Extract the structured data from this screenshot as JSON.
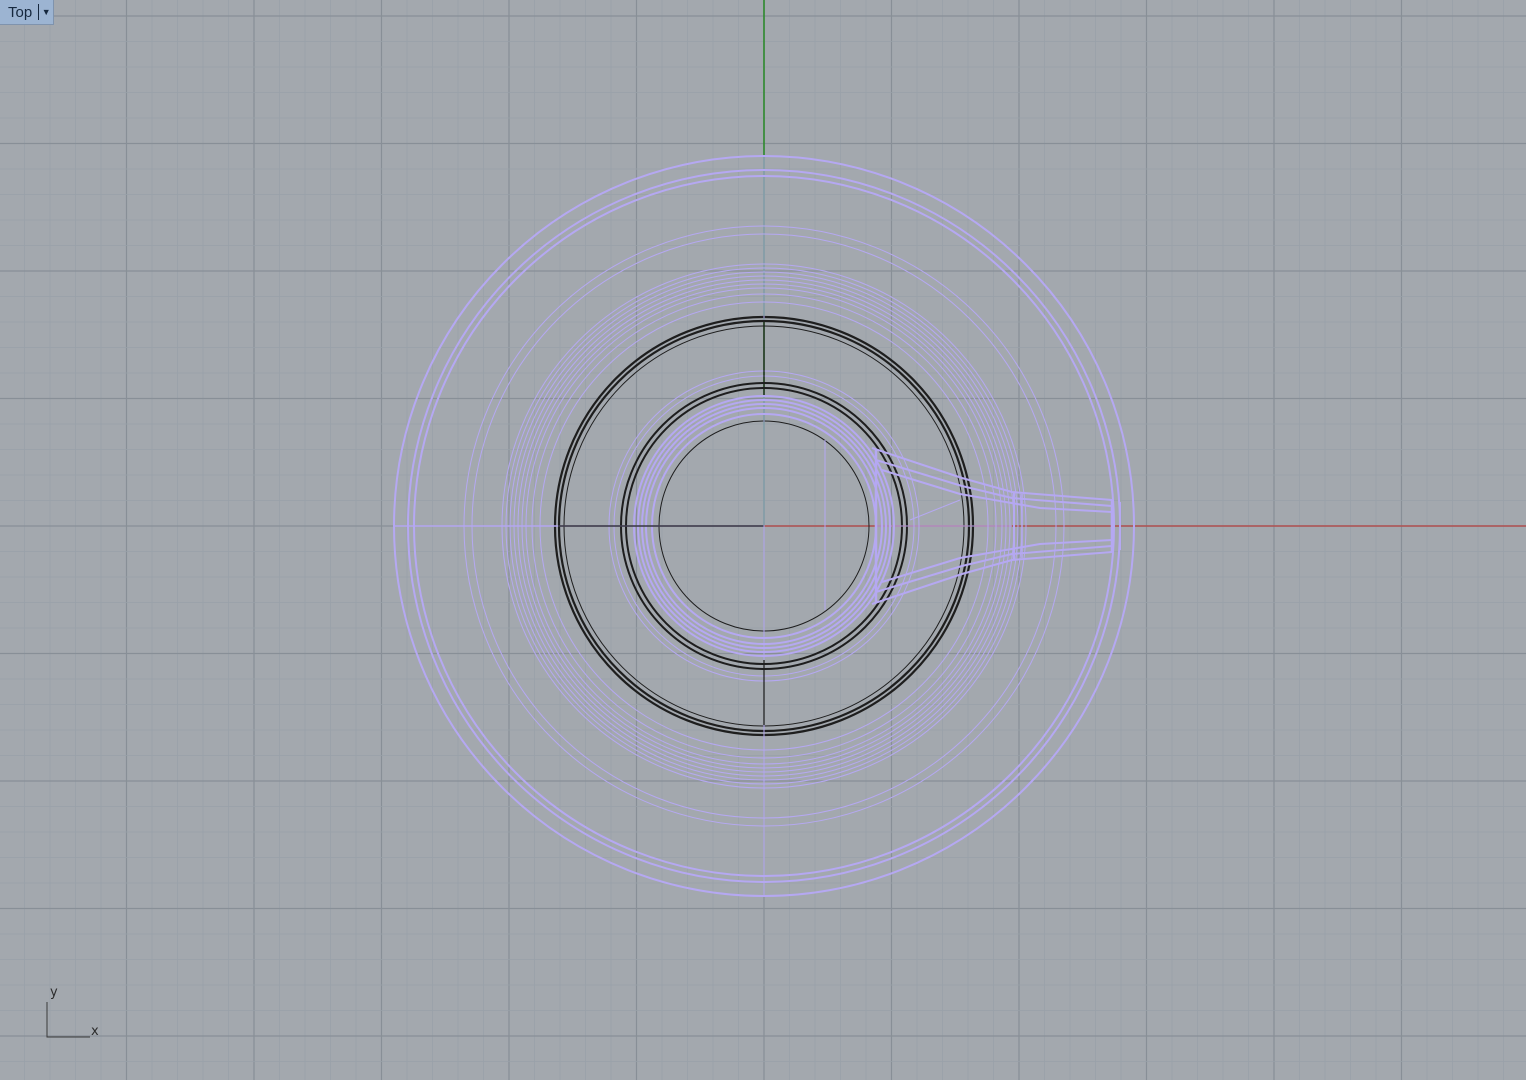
{
  "viewport": {
    "view_name": "Top",
    "dropdown_icon": "triangle-down-icon",
    "world_axes_label": {
      "y": "y",
      "x": "x"
    }
  },
  "colors": {
    "background": "#a3a8ae",
    "grid_minor": "#98a0a8",
    "grid_major": "#888f97",
    "x_axis": "#b05050",
    "y_axis": "#2e8a2e",
    "selected_curve": "#b5a8f2",
    "curve": "#1e1e1e"
  }
}
